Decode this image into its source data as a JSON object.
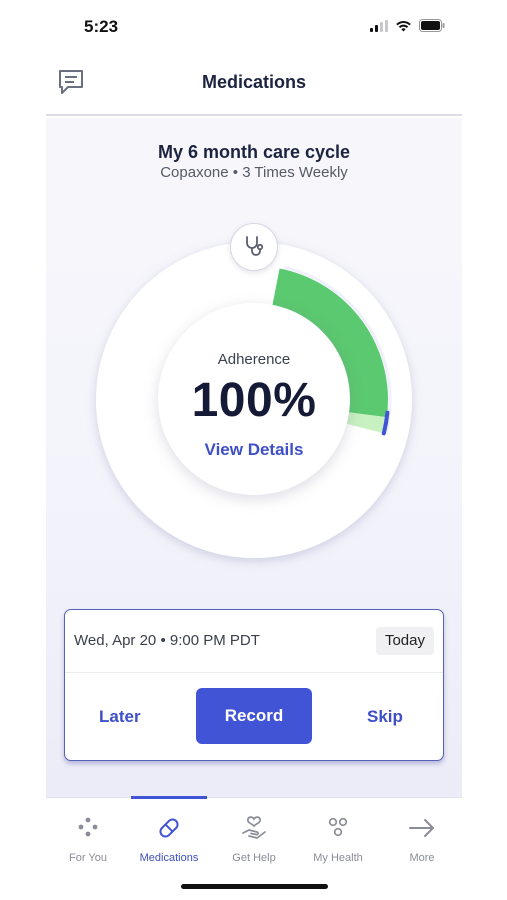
{
  "status_bar": {
    "time": "5:23"
  },
  "header": {
    "title": "Medications"
  },
  "cycle": {
    "title": "My 6 month care cycle",
    "subtitle": "Copaxone • 3 Times Weekly"
  },
  "adherence": {
    "label": "Adherence",
    "value": "100%",
    "details_link": "View Details",
    "cycle_progress_fraction": 0.29
  },
  "reminder": {
    "datetime": "Wed, Apr 20 • 9:00 PM PDT",
    "badge": "Today",
    "later_label": "Later",
    "record_label": "Record",
    "skip_label": "Skip"
  },
  "tabs": [
    {
      "label": "For You",
      "icon": "dots-icon",
      "active": false
    },
    {
      "label": "Medications",
      "icon": "pill-icon",
      "active": true
    },
    {
      "label": "Get Help",
      "icon": "heart-hand-icon",
      "active": false
    },
    {
      "label": "My Health",
      "icon": "circles-icon",
      "active": false
    },
    {
      "label": "More",
      "icon": "arrow-right-icon",
      "active": false
    }
  ],
  "colors": {
    "accent": "#4254d6",
    "progress_green": "#5bc96f",
    "progress_light_green": "#c8f1c2",
    "text_dark": "#1c2440"
  }
}
